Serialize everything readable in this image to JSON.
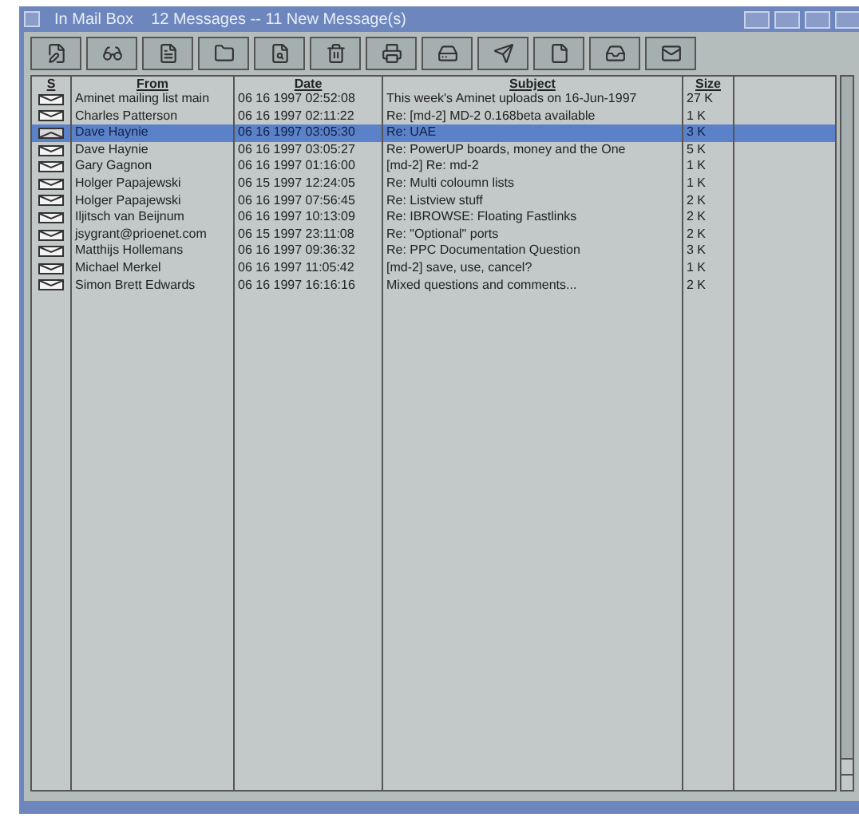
{
  "window": {
    "title": "In Mail Box    12 Messages -- 11 New Message(s)"
  },
  "table": {
    "columns": [
      "S",
      "From",
      "Date",
      "Subject",
      "Size"
    ],
    "rows": [
      {
        "new": true,
        "selected": false,
        "from": "Aminet mailing list main",
        "date": "06 16 1997 02:52:08",
        "subject": "This week's Aminet uploads on 16-Jun-1997",
        "size": "27 K"
      },
      {
        "new": true,
        "selected": false,
        "from": "Charles Patterson",
        "date": "06 16 1997 02:11:22",
        "subject": "Re: [md-2] MD-2 0.168beta available",
        "size": "1 K"
      },
      {
        "new": false,
        "selected": true,
        "from": "Dave Haynie",
        "date": "06 16 1997 03:05:30",
        "subject": "Re: UAE",
        "size": "3 K"
      },
      {
        "new": true,
        "selected": false,
        "from": "Dave Haynie",
        "date": "06 16 1997 03:05:27",
        "subject": "Re: PowerUP boards, money and the One",
        "size": "5 K"
      },
      {
        "new": true,
        "selected": false,
        "from": "Gary Gagnon",
        "date": "06 16 1997 01:16:00",
        "subject": "[md-2] Re: md-2",
        "size": "1 K"
      },
      {
        "new": true,
        "selected": false,
        "from": "Holger Papajewski",
        "date": "06 15 1997 12:24:05",
        "subject": "Re: Multi coloumn lists",
        "size": "1 K"
      },
      {
        "new": true,
        "selected": false,
        "from": "Holger Papajewski",
        "date": "06 16 1997 07:56:45",
        "subject": "Re: Listview stuff",
        "size": "2 K"
      },
      {
        "new": true,
        "selected": false,
        "from": "Iljitsch van Beijnum",
        "date": "06 16 1997 10:13:09",
        "subject": "Re: IBROWSE: Floating Fastlinks",
        "size": "2 K"
      },
      {
        "new": true,
        "selected": false,
        "from": "jsygrant@prioenet.com",
        "date": "06 15 1997 23:11:08",
        "subject": "Re: \"Optional\" ports",
        "size": "2 K"
      },
      {
        "new": true,
        "selected": false,
        "from": "Matthijs Hollemans",
        "date": "06 16 1997 09:36:32",
        "subject": "Re: PPC Documentation Question",
        "size": "3 K"
      },
      {
        "new": true,
        "selected": false,
        "from": "Michael Merkel",
        "date": "06 16 1997 11:05:42",
        "subject": "[md-2] save, use, cancel?",
        "size": "1 K"
      },
      {
        "new": true,
        "selected": false,
        "from": "Simon Brett Edwards",
        "date": "06 16 1997 16:16:16",
        "subject": "Mixed questions and comments...",
        "size": "2 K"
      }
    ]
  }
}
